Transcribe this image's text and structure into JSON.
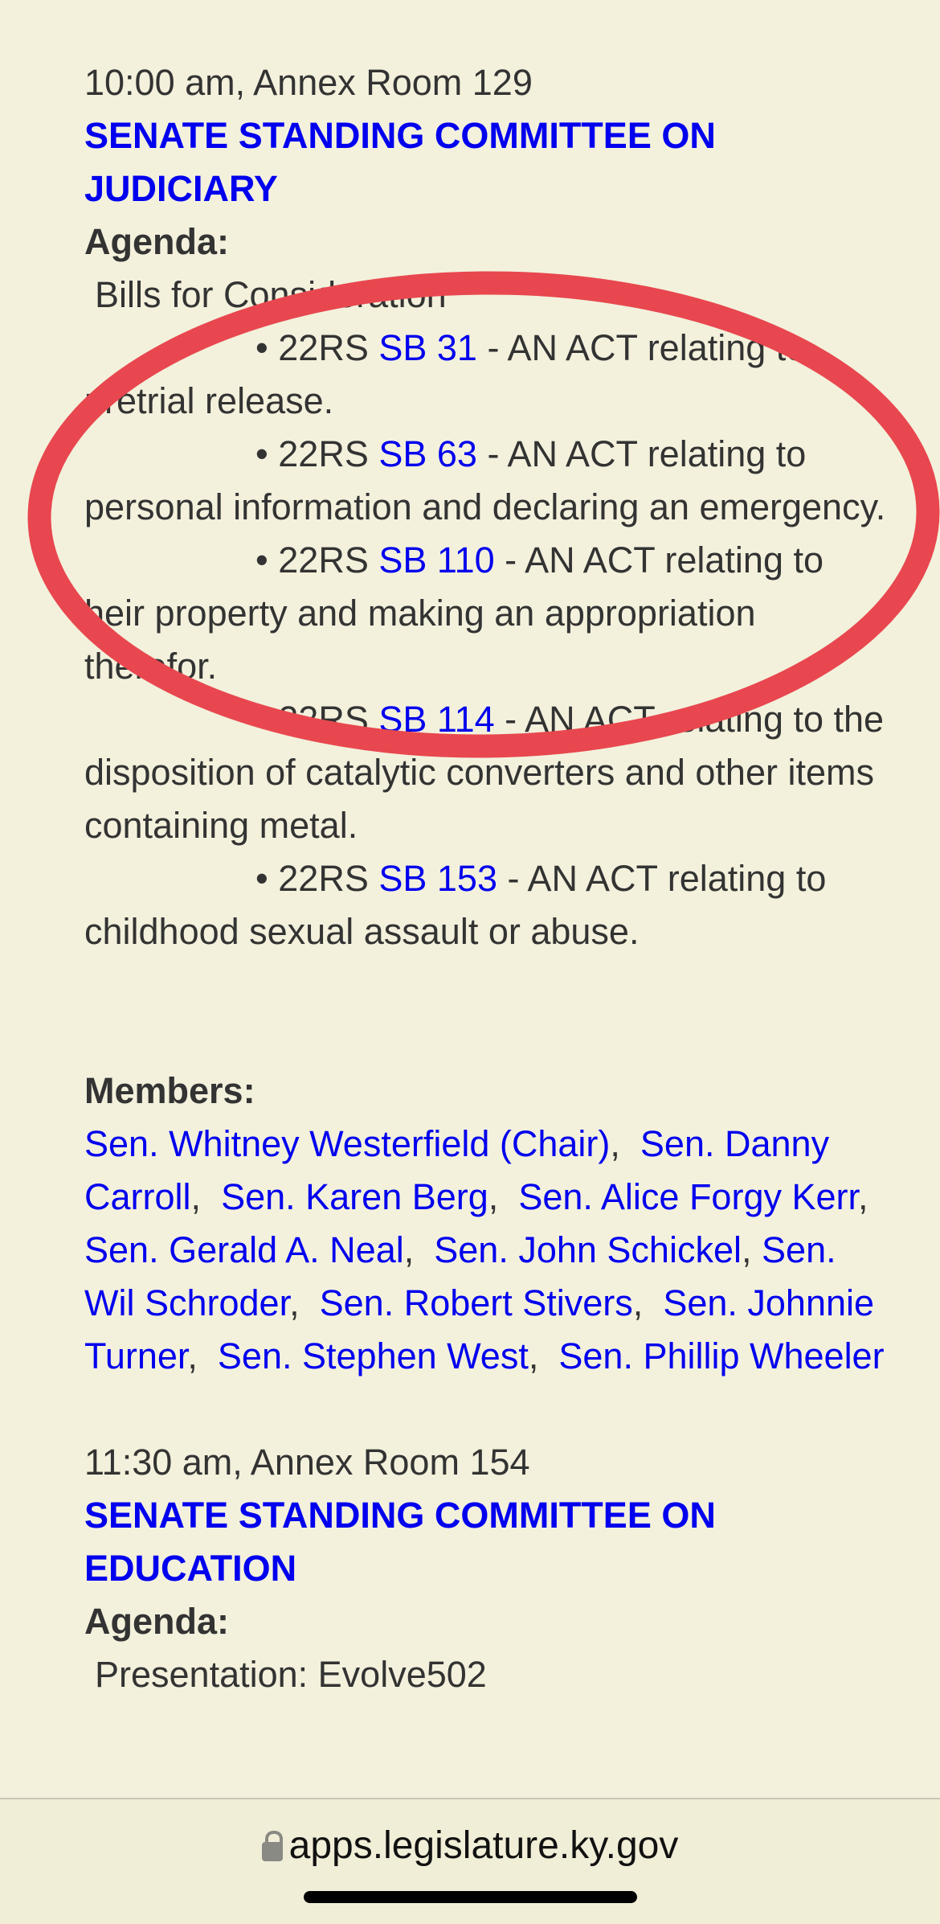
{
  "meetings": [
    {
      "time_location": "10:00 am, Annex Room 129",
      "committee": "SENATE STANDING COMMITTEE ON JUDICIARY",
      "agenda_label": "Agenda:",
      "agenda_heading": "Bills for Consideration",
      "bills": [
        {
          "bullet": "•",
          "session": "22RS",
          "bill": "SB 31",
          "description": " - AN ACT relating to pretrial release."
        },
        {
          "bullet": "•",
          "session": "22RS",
          "bill": "SB 63",
          "description": " - AN ACT relating to personal information and declaring an emergency."
        },
        {
          "bullet": "•",
          "session": "22RS",
          "bill": "SB 110",
          "description": " - AN ACT relating to heir property and making an appropriation therefor."
        },
        {
          "bullet": "•",
          "session": "22RS",
          "bill": "SB 114",
          "description": " - AN ACT relating to the disposition of catalytic converters and other items containing metal."
        },
        {
          "bullet": "•",
          "session": "22RS",
          "bill": "SB 153",
          "description": " - AN ACT relating to childhood sexual assault or abuse."
        }
      ],
      "members_label": "Members:",
      "members": [
        "Sen. Whitney Westerfield (Chair)",
        "Sen. Danny Carroll",
        "Sen. Karen Berg",
        "Sen. Alice Forgy Kerr",
        "Sen. Gerald A. Neal",
        "Sen. John Schickel",
        "Sen. Wil Schroder",
        "Sen. Robert Stivers",
        "Sen. Johnnie Turner",
        "Sen. Stephen West",
        "Sen. Phillip Wheeler"
      ]
    },
    {
      "time_location": "11:30 am, Annex Room 154",
      "committee": "SENATE STANDING COMMITTEE ON EDUCATION",
      "agenda_label": "Agenda:",
      "agenda_heading": "Presentation: Evolve502"
    }
  ],
  "browser": {
    "url": "apps.legislature.ky.gov",
    "lock_icon": "lock-icon"
  },
  "annotation": {
    "shape": "ellipse",
    "color": "#E8474F"
  },
  "colors": {
    "background": "#F3F1DC",
    "text": "#333333",
    "link": "#0000EE"
  }
}
